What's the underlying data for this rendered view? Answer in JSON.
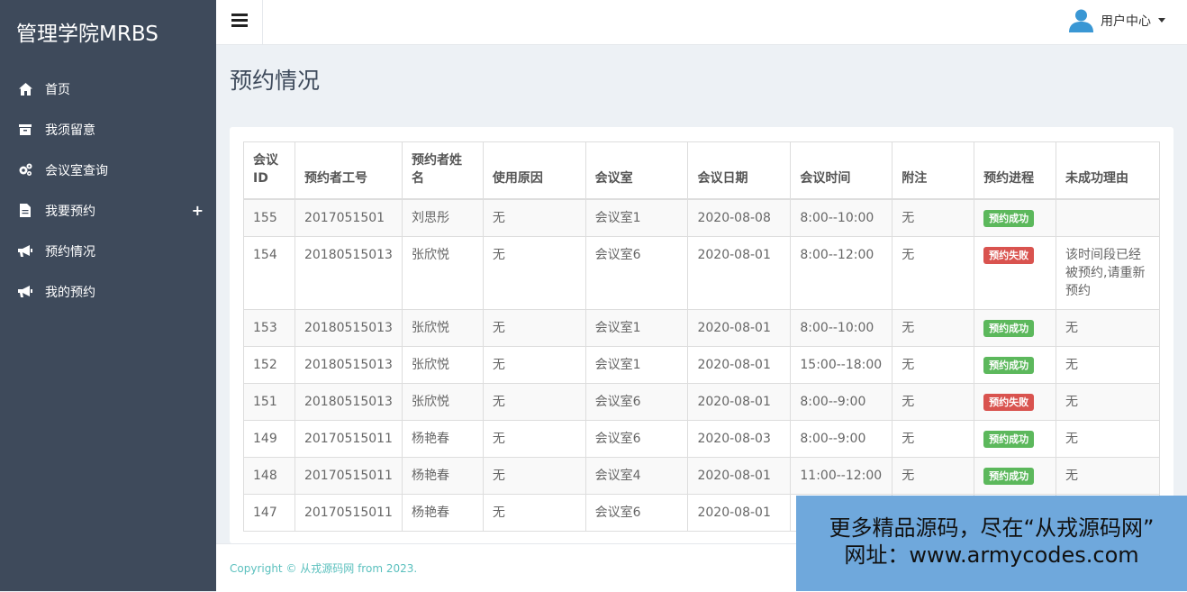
{
  "sidebar": {
    "brand": "管理学院MRBS",
    "items": [
      {
        "label": "首页",
        "icon": "home-icon"
      },
      {
        "label": "我须留意",
        "icon": "archive-icon"
      },
      {
        "label": "会议室查询",
        "icon": "gears-icon"
      },
      {
        "label": "我要预约",
        "icon": "file-icon",
        "expand": "+"
      },
      {
        "label": "预约情况",
        "icon": "bullhorn-icon"
      },
      {
        "label": "我的预约",
        "icon": "bullhorn-icon"
      }
    ]
  },
  "header": {
    "user_label": "用户中心"
  },
  "main": {
    "title": "预约情况",
    "table": {
      "headers": [
        "会议ID",
        "预约者工号",
        "预约者姓名",
        "使用原因",
        "会议室",
        "会议日期",
        "会议时间",
        "附注",
        "预约进程",
        "未成功理由"
      ],
      "rows": [
        {
          "id": "155",
          "emp": "2017051501",
          "name": "刘思彤",
          "reason": "无",
          "room": "会议室1",
          "date": "2020-08-08",
          "time": "8:00--10:00",
          "note": "无",
          "status": "预约成功",
          "fail_reason": ""
        },
        {
          "id": "154",
          "emp": "20180515013",
          "name": "张欣悦",
          "reason": "无",
          "room": "会议室6",
          "date": "2020-08-01",
          "time": "8:00--12:00",
          "note": "无",
          "status": "预约失败",
          "fail_reason": "该时间段已经被预约,请重新预约"
        },
        {
          "id": "153",
          "emp": "20180515013",
          "name": "张欣悦",
          "reason": "无",
          "room": "会议室1",
          "date": "2020-08-01",
          "time": "8:00--10:00",
          "note": "无",
          "status": "预约成功",
          "fail_reason": "无"
        },
        {
          "id": "152",
          "emp": "20180515013",
          "name": "张欣悦",
          "reason": "无",
          "room": "会议室1",
          "date": "2020-08-01",
          "time": "15:00--18:00",
          "note": "无",
          "status": "预约成功",
          "fail_reason": "无"
        },
        {
          "id": "151",
          "emp": "20180515013",
          "name": "张欣悦",
          "reason": "无",
          "room": "会议室6",
          "date": "2020-08-01",
          "time": "8:00--9:00",
          "note": "无",
          "status": "预约失败",
          "fail_reason": "无"
        },
        {
          "id": "149",
          "emp": "20170515011",
          "name": "杨艳春",
          "reason": "无",
          "room": "会议室6",
          "date": "2020-08-03",
          "time": "8:00--9:00",
          "note": "无",
          "status": "预约成功",
          "fail_reason": "无"
        },
        {
          "id": "148",
          "emp": "20170515011",
          "name": "杨艳春",
          "reason": "无",
          "room": "会议室4",
          "date": "2020-08-01",
          "time": "11:00--12:00",
          "note": "无",
          "status": "预约成功",
          "fail_reason": "无"
        },
        {
          "id": "147",
          "emp": "20170515011",
          "name": "杨艳春",
          "reason": "无",
          "room": "会议室6",
          "date": "2020-08-01",
          "time": "",
          "note": "",
          "status": "",
          "fail_reason": ""
        }
      ]
    }
  },
  "footer": {
    "copyright": "Copyright © 从戎源码网 from 2023."
  },
  "watermark": {
    "line1": "更多精品源码，尽在“从戎源码网”",
    "line2": "网址：www.armycodes.com"
  },
  "colors": {
    "sidebar_bg": "#3e4a5b",
    "success": "#5cb85c",
    "fail": "#d9534f",
    "user_icon": "#3a97d4",
    "footer_text": "#5bc0be",
    "watermark_bg": "#6fa8dc"
  }
}
